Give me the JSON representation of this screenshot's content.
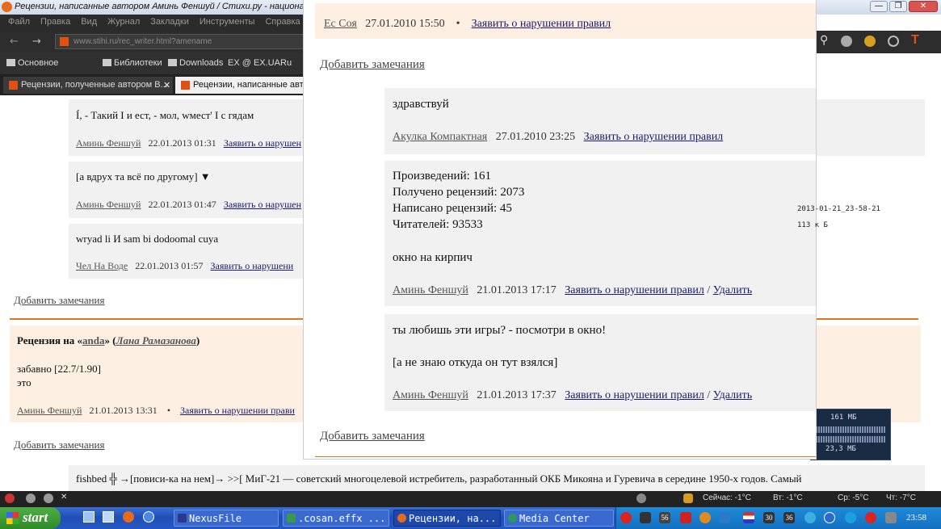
{
  "window": {
    "title": "Рецензии, написанные автором Аминь Феншуй / Стихи.ру - национальн...",
    "controls": [
      "—",
      "❐",
      "✕"
    ]
  },
  "menu": [
    "Файл",
    "Правка",
    "Вид",
    "Журнал",
    "Закладки",
    "Инструменты",
    "Справка"
  ],
  "address_bar": {
    "url": "www.stihi.ru/rec_writer.html?amename"
  },
  "bookmarks": [
    "Основное",
    "Библиотеки",
    "Downloads",
    "EX @ EX.UA",
    "Ru"
  ],
  "tabs": [
    {
      "label": "Рецензии, полученные автором В...",
      "close": "✕"
    },
    {
      "label": "Рецензии, написанные автор"
    }
  ],
  "background_page": {
    "reviews": [
      {
        "text": "Í, - Такий I и ест, - мол, wмест' I с гядам",
        "author": "Аминь Феншуй",
        "date": "22.01.2013 01:31",
        "report": "Заявить о нарушен"
      },
      {
        "text": "[а вдрух та всё по другому] ▼",
        "author": "Аминь Феншуй",
        "date": "22.01.2013 01:47",
        "report": "Заявить о нарушен"
      },
      {
        "text": "wryad li И sam bi dodoomal cuya",
        "author": "Чел На Воде",
        "date": "22.01.2013 01:57",
        "report": "Заявить о нарушени"
      }
    ],
    "add_remark_1": "Добавить замечания",
    "recenzia": {
      "prefix": "Рецензия на «",
      "work": "anda",
      "middle": "» (",
      "work_author": "Лана Рамазанова",
      "suffix": ")",
      "line1": "забавно [22.7/1.90]",
      "line2": "это",
      "author": "Аминь Феншуй",
      "date": "21.01.2013 13:31",
      "bullet": "•",
      "report": "Заявить о нарушении прави"
    },
    "add_remark_2": "Добавить замечания",
    "bottom_text_1": "fishbed ╬ →[повиси-ка на нем]→ >>[ МиГ-21 — советский многоцелевой истребитель, разработанный ОКБ Микояна и Гуревича в середине 1950-х годов. Самый"
  },
  "popup": {
    "top_meta": {
      "author": "Ес Соя",
      "date": "27.01.2010 15:50",
      "bullet": "•",
      "report": "Заявить о нарушении правил"
    },
    "add_remark_top": "Добавить замечания",
    "reply1": {
      "text": "здравствуй",
      "author": "Акулка Компактная",
      "date": "27.01.2010 23:25",
      "report": "Заявить о нарушении правил"
    },
    "stats": {
      "works": "Произведений: 161",
      "received": "Получено рецензий: 2073",
      "written": "Написано рецензий: 45",
      "readers": "Читателей: 93533",
      "note": "окно на кирпич",
      "author": "Аминь Феншуй",
      "date": "21.01.2013 17:17",
      "report": "Заявить о нарушении правил",
      "sep": "/",
      "delete": "Удалить"
    },
    "side_file": {
      "name": "2013-01-21_23-58-21",
      "size": "113 к Б"
    },
    "reply3": {
      "line1": "ты любишь эти игры? - посмотри в окно!",
      "line2": "[а не знаю откуда он тут взялся]",
      "author": "Аминь Феншуй",
      "date": "21.01.2013 17:37",
      "report": "Заявить о нарушении правил",
      "sep": "/",
      "delete": "Удалить"
    },
    "add_remark_bottom": "Добавить замечания"
  },
  "sysmon": {
    "mem1": "161 МБ",
    "mem2": "23,3 МБ"
  },
  "statusbar": {
    "weather": "Сейчас: -1°C",
    "day1": "Вт: -1°C",
    "day2": "Ср: -5°C",
    "day3": "Чт: -7°C"
  },
  "taskbar": {
    "start": "start",
    "tasks": [
      "NexusFile",
      ".cosan.effx ...",
      "Рецензии, на...",
      "Media Center"
    ],
    "tray_numbers": [
      "56",
      "30",
      "36"
    ],
    "clock": "23:58"
  },
  "colors": {
    "accent_orange": "#e0761f",
    "link": "#1a1a6e",
    "popup_header_bg": "#fdf0e2",
    "review_bg": "#f1f1f1"
  }
}
